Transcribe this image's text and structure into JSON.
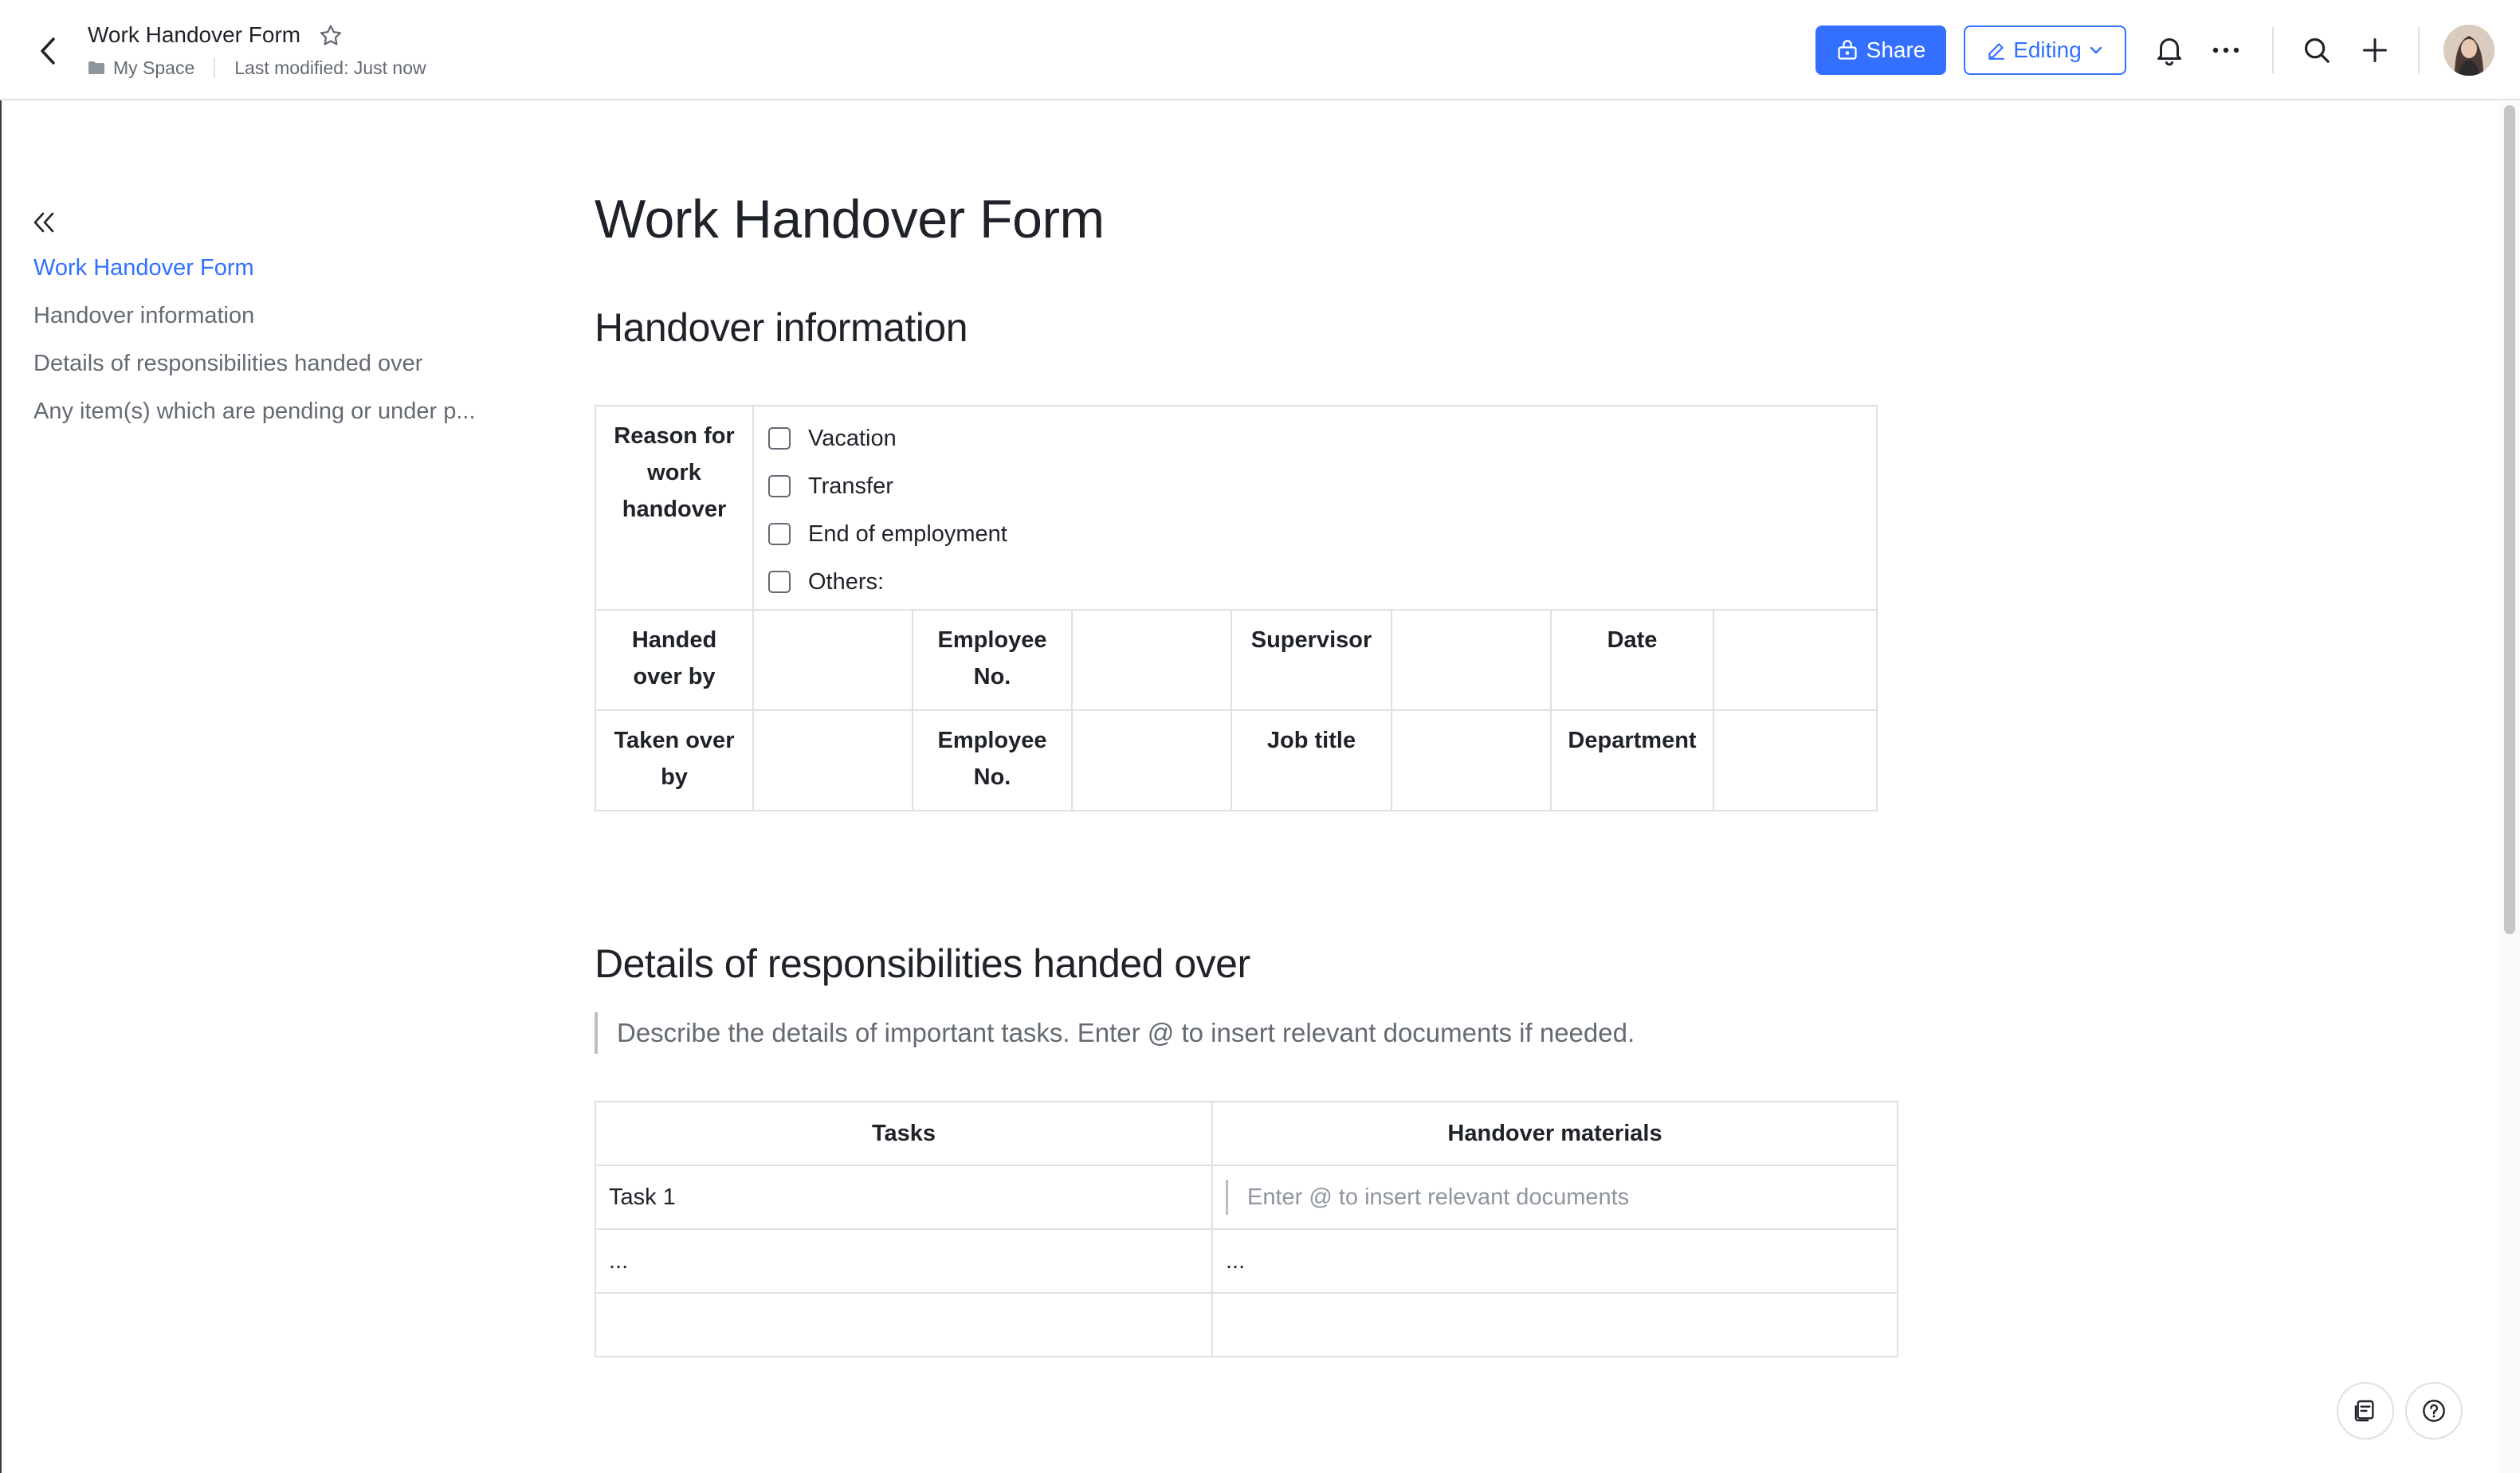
{
  "header": {
    "doc_title": "Work Handover Form",
    "location": "My Space",
    "last_modified": "Last modified: Just now",
    "share_label": "Share",
    "editing_label": "Editing"
  },
  "outline": {
    "items": [
      "Work Handover Form",
      "Handover information",
      "Details of responsibilities handed over",
      "Any item(s) which are pending or under p..."
    ]
  },
  "document": {
    "title": "Work Handover Form",
    "section1_heading": "Handover information",
    "handover_table": {
      "reason_label": "Reason for work handover",
      "reasons": [
        "Vacation",
        "Transfer",
        "End of employment",
        "Others:"
      ],
      "handed_over_by": "Handed over by",
      "employee_no": "Employee No.",
      "supervisor": "Supervisor",
      "date": "Date",
      "taken_over_by": "Taken over by",
      "job_title": "Job title",
      "department": "Department"
    },
    "section2_heading": "Details of responsibilities handed over",
    "section2_hint": "Describe the details of important tasks. Enter @ to insert relevant documents if needed.",
    "tasks_table": {
      "headers": [
        "Tasks",
        "Handover materials"
      ],
      "rows": [
        [
          "Task 1",
          "Enter @ to insert relevant documents"
        ],
        [
          "...",
          "..."
        ],
        [
          "",
          ""
        ]
      ]
    }
  },
  "colors": {
    "accent": "#3370ff",
    "text": "#1f2329",
    "muted": "#646a73",
    "border": "#dee0e3"
  }
}
